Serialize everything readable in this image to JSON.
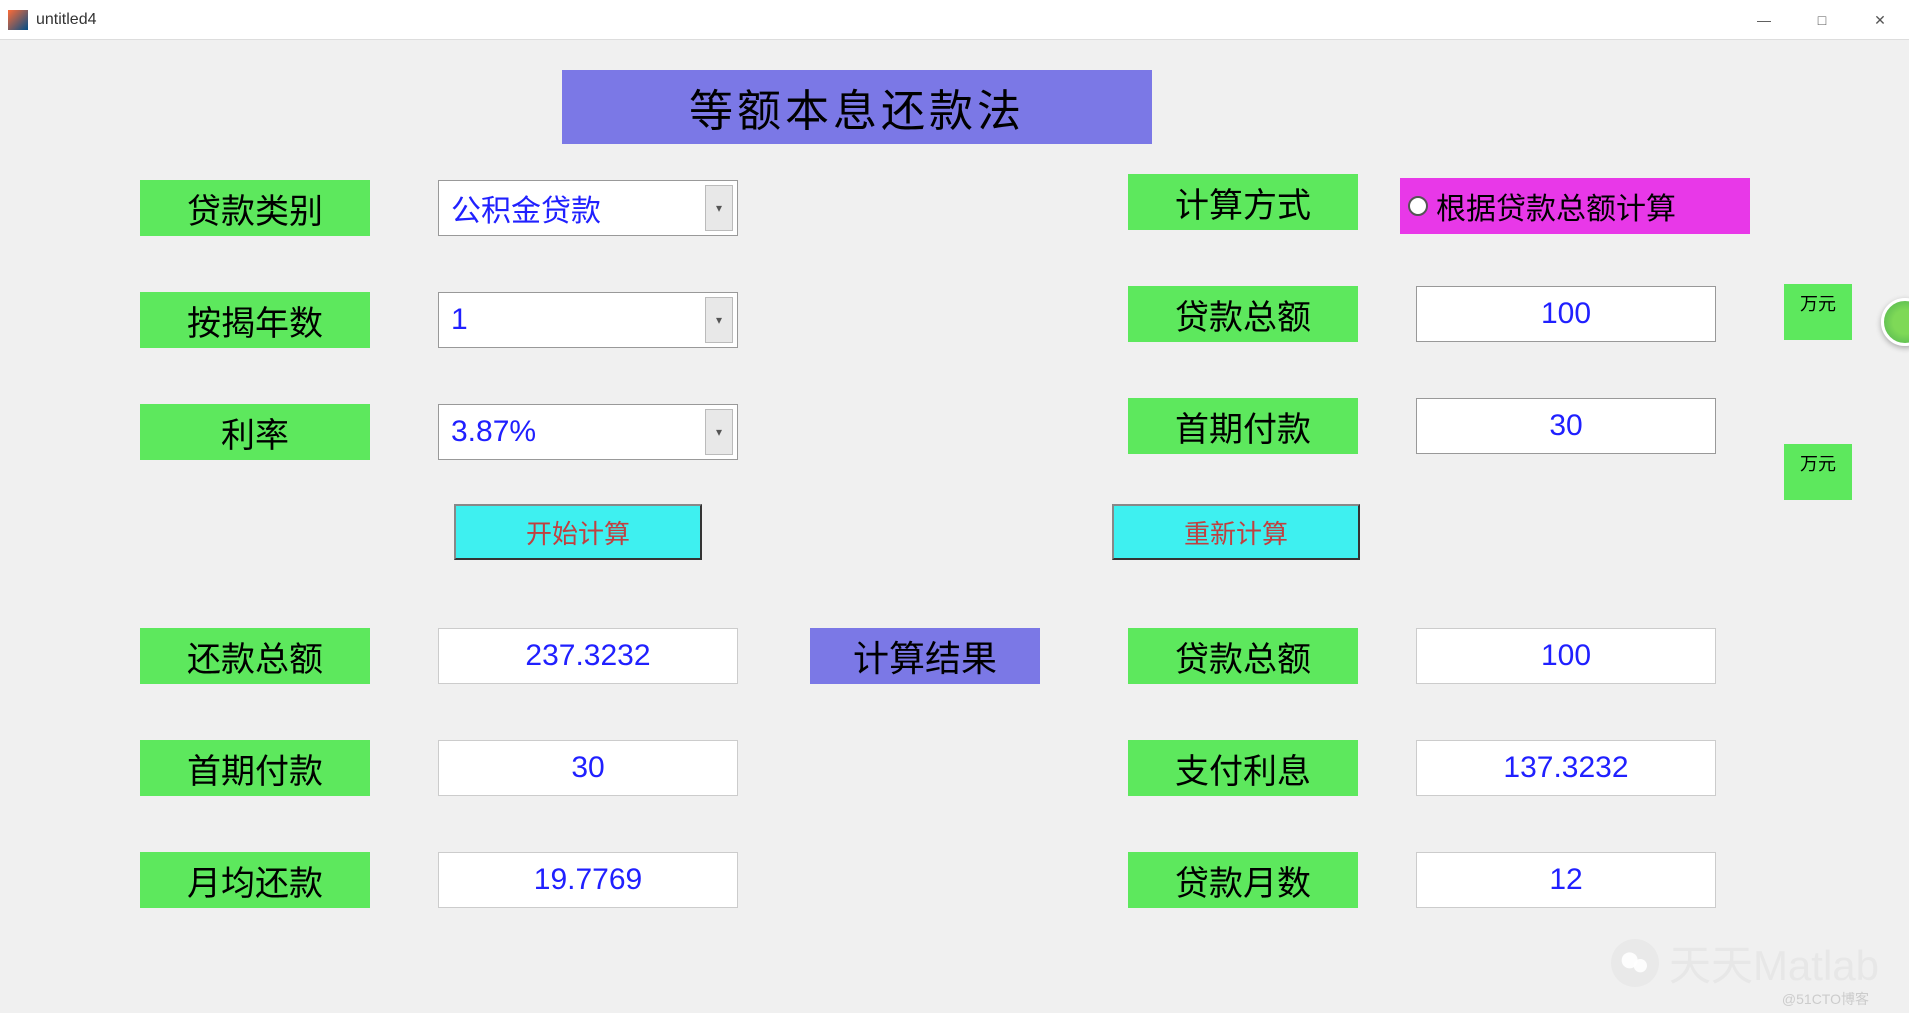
{
  "window": {
    "title": "untitled4",
    "minimize": "—",
    "maximize": "□",
    "close": "✕"
  },
  "header": {
    "title": "等额本息还款法"
  },
  "labels": {
    "loan_type": "贷款类别",
    "mortgage_years": "按揭年数",
    "rate": "利率",
    "calc_method": "计算方式",
    "loan_total": "贷款总额",
    "first_payment": "首期付款",
    "unit_wan": "万元"
  },
  "inputs": {
    "loan_type_value": "公积金贷款",
    "mortgage_years_value": "1",
    "rate_value": "3.87%",
    "loan_total_value": "100",
    "first_payment_value": "30",
    "calc_method_option": "根据贷款总额计算"
  },
  "buttons": {
    "start": "开始计算",
    "reset": "重新计算"
  },
  "results": {
    "header": "计算结果",
    "repay_total_label": "还款总额",
    "repay_total_value": "237.3232",
    "first_payment_label": "首期付款",
    "first_payment_value": "30",
    "monthly_avg_label": "月均还款",
    "monthly_avg_value": "19.7769",
    "loan_total_label": "贷款总额",
    "loan_total_value": "100",
    "interest_label": "支付利息",
    "interest_value": "137.3232",
    "months_label": "贷款月数",
    "months_value": "12"
  },
  "watermark": {
    "text": "天天Matlab",
    "small": "@51CTO博客"
  }
}
